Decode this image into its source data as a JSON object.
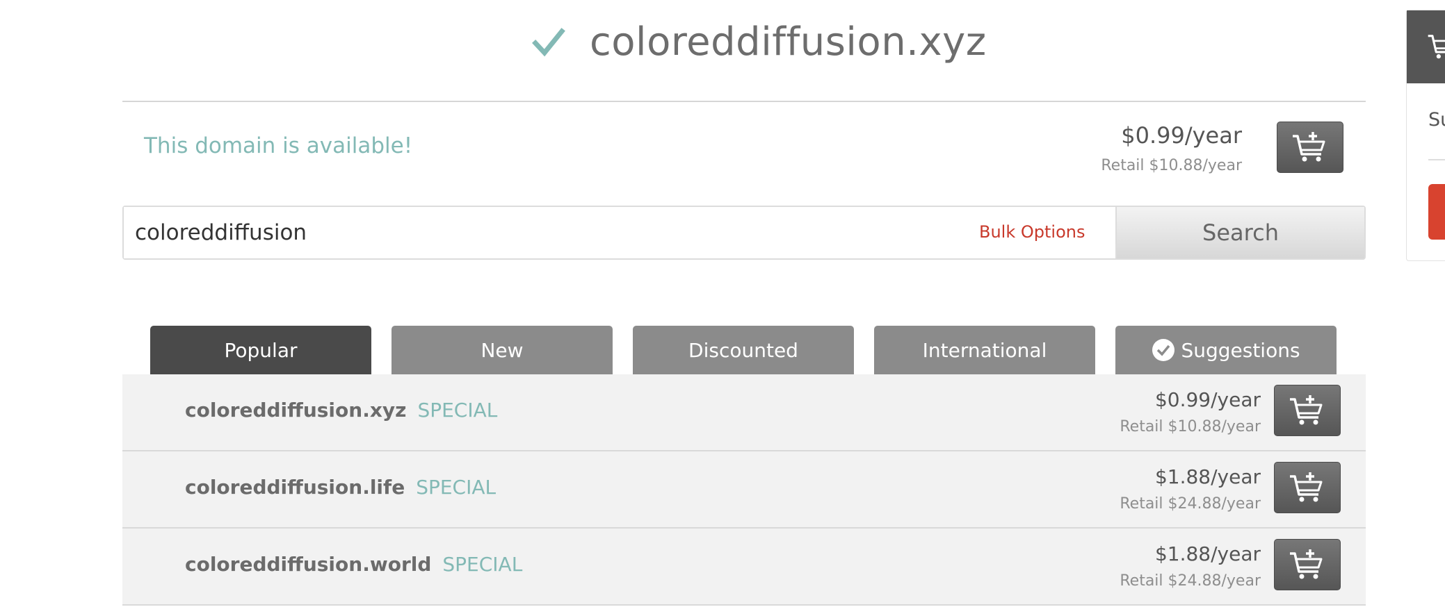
{
  "header": {
    "domain": "coloreddiffusion.xyz",
    "check_icon": "check-icon"
  },
  "availability": {
    "message": "This domain is available!",
    "price": "$0.99/year",
    "retail": "Retail $10.88/year"
  },
  "search": {
    "value": "coloreddiffusion",
    "bulk_label": "Bulk Options",
    "button_label": "Search"
  },
  "tabs": [
    {
      "label": "Popular",
      "active": true
    },
    {
      "label": "New",
      "active": false
    },
    {
      "label": "Discounted",
      "active": false
    },
    {
      "label": "International",
      "active": false
    },
    {
      "label": "Suggestions",
      "active": false
    }
  ],
  "results": [
    {
      "domain": "coloreddiffusion.xyz",
      "badge": "SPECIAL",
      "price": "$0.99/year",
      "retail": "Retail $10.88/year"
    },
    {
      "domain": "coloreddiffusion.life",
      "badge": "SPECIAL",
      "price": "$1.88/year",
      "retail": "Retail $24.88/year"
    },
    {
      "domain": "coloreddiffusion.world",
      "badge": "SPECIAL",
      "price": "$1.88/year",
      "retail": "Retail $24.88/year"
    }
  ],
  "side_panel": {
    "text": "Su"
  },
  "colors": {
    "accent_teal": "#83b9b5",
    "link_red": "#c8392b",
    "tab_active": "#4a4a4a",
    "tab_inactive": "#8b8b8b"
  }
}
